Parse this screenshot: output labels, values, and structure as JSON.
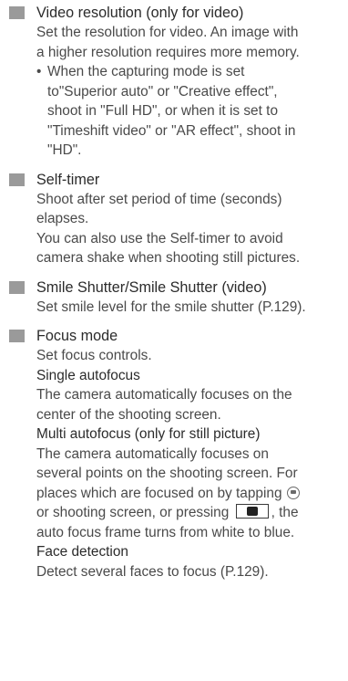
{
  "sections": [
    {
      "heading": "Video resolution (only for video)",
      "lines": [
        "Set the resolution for video. An image with",
        "a higher resolution requires more memory."
      ],
      "bullet": {
        "marker": "•",
        "lines": [
          "When the capturing mode is set",
          "to\"Superior auto\" or \"Creative effect\",",
          "shoot in \"Full HD\", or when it is set to",
          "\"Timeshift video\" or \"AR effect\", shoot in",
          "\"HD\"."
        ]
      }
    },
    {
      "heading": "Self-timer",
      "lines": [
        "Shoot after set period of time (seconds)",
        "elapses.",
        "You can also use the Self-timer to avoid",
        "camera shake when shooting still pictures."
      ]
    },
    {
      "heading": "Smile Shutter/Smile Shutter (video)",
      "lines": [
        "Set smile level for the smile shutter (P.129)."
      ]
    },
    {
      "heading": "Focus mode",
      "lines": [
        "Set focus controls."
      ],
      "subsections": [
        {
          "title": "Single autofocus",
          "lines": [
            "The camera automatically focuses on the",
            "center of the shooting screen."
          ]
        },
        {
          "title": "Multi autofocus (only for still picture)",
          "lines": [
            "The camera automatically focuses on",
            "several points on the shooting screen. For"
          ],
          "line_icons_a": "places which are focused on by tapping",
          "line_icons_b": "or shooting screen, or pressing",
          "line_icons_c": ", the",
          "tail": "auto focus frame turns from white to blue."
        },
        {
          "title": "Face detection",
          "lines": [
            "Detect several faces to focus (P.129)."
          ]
        }
      ]
    }
  ],
  "icons": [
    "camera-circle-icon",
    "camera-button-icon"
  ]
}
